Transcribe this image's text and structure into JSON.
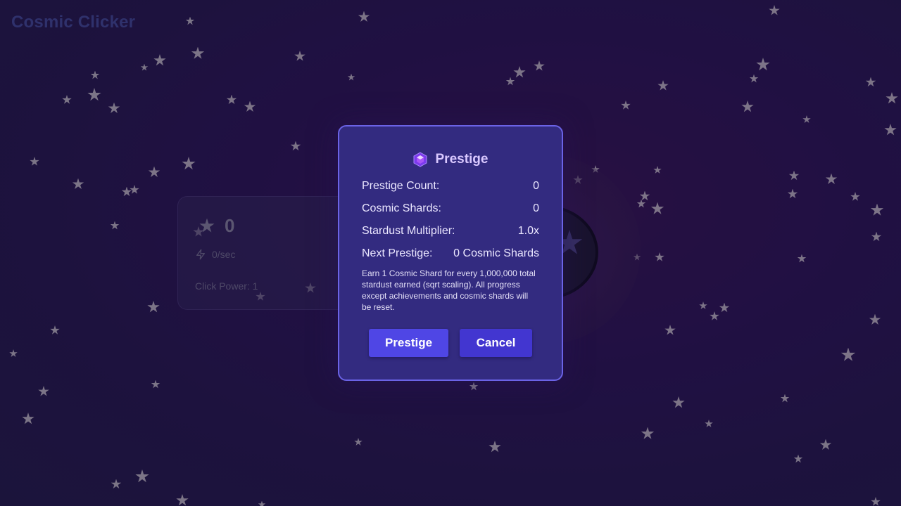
{
  "app": {
    "title": "Cosmic Clicker"
  },
  "stats": {
    "stardust": "0",
    "rate": "0/sec",
    "click_power": "Click Power: 1",
    "icons": [
      "star-icon",
      "lightning-icon"
    ]
  },
  "modal": {
    "title": "Prestige",
    "icon": "gem-icon",
    "rows": [
      {
        "label": "Prestige Count:",
        "value": "0"
      },
      {
        "label": "Cosmic Shards:",
        "value": "0"
      },
      {
        "label": "Stardust Multiplier:",
        "value": "1.0x"
      },
      {
        "label": "Next Prestige:",
        "value": "0 Cosmic Shards"
      }
    ],
    "description": "Earn 1 Cosmic Shard for every 1,000,000 total stardust earned (sqrt scaling). All progress except achievements and cosmic shards will be reset.",
    "buttons": {
      "prestige": "Prestige",
      "cancel": "Cancel"
    }
  },
  "colors": {
    "modal_bg": "#332b80",
    "modal_border": "#6b63e6",
    "primary_button": "#4f46e5",
    "secondary_button": "#4236d0",
    "title_accent": "#d9c8ff",
    "background": "#1f1444"
  }
}
